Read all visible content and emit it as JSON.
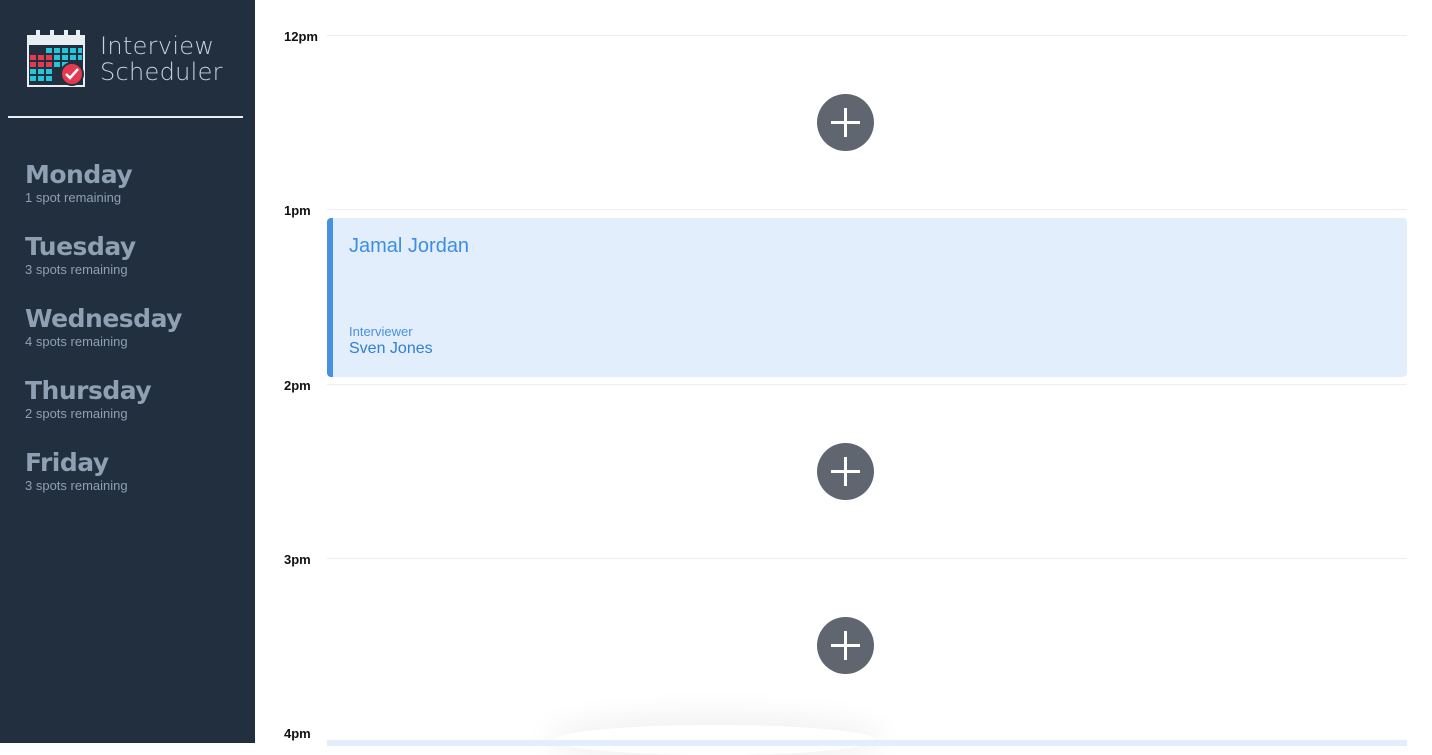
{
  "app": {
    "title_line1": "Interview",
    "title_line2": "Scheduler",
    "logo_icon": "calendar-check-icon"
  },
  "sidebar": {
    "days": [
      {
        "name": "Monday",
        "spots": "1 spot remaining"
      },
      {
        "name": "Tuesday",
        "spots": "3 spots remaining"
      },
      {
        "name": "Wednesday",
        "spots": "4 spots remaining"
      },
      {
        "name": "Thursday",
        "spots": "2 spots remaining"
      },
      {
        "name": "Friday",
        "spots": "3 spots remaining"
      }
    ]
  },
  "schedule": {
    "times": [
      "12pm",
      "1pm",
      "2pm",
      "3pm",
      "4pm"
    ],
    "appointment": {
      "student": "Jamal Jordan",
      "interviewer_label": "Interviewer",
      "interviewer": "Sven Jones"
    },
    "add_icon": "plus-icon"
  },
  "colors": {
    "sidebar_bg": "#222f3e",
    "accent": "#4a90e2",
    "card_bg": "#e3eefc",
    "add_button": "#5f6670"
  }
}
